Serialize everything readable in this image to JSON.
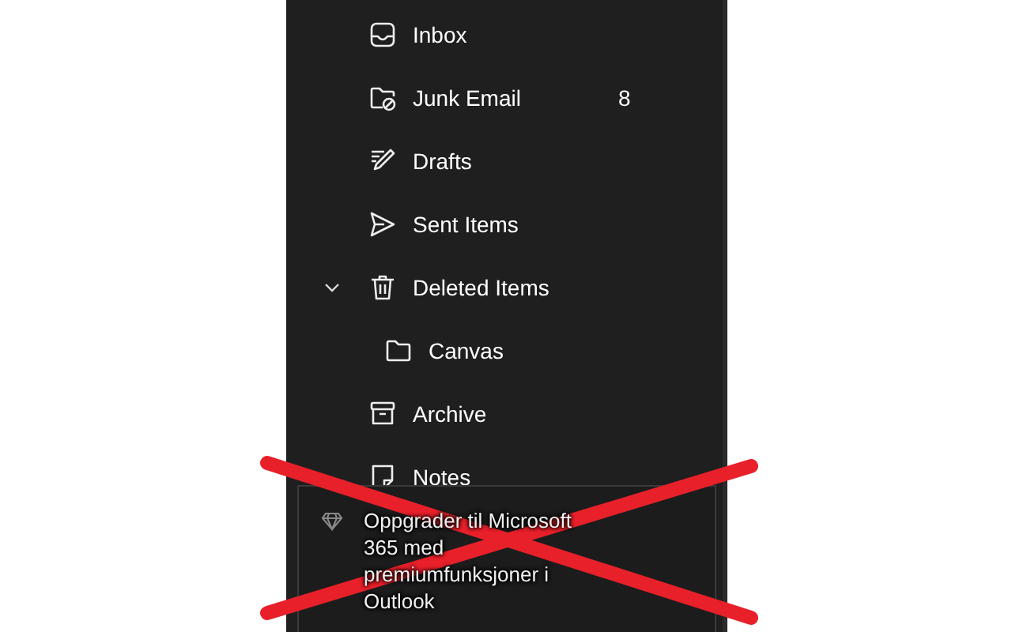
{
  "folders": [
    {
      "name": "Inbox"
    },
    {
      "name": "Junk Email",
      "count": "8"
    },
    {
      "name": "Drafts"
    },
    {
      "name": "Sent Items"
    },
    {
      "name": "Deleted Items",
      "expanded": true,
      "children": [
        {
          "name": "Canvas"
        }
      ]
    },
    {
      "name": "Archive"
    },
    {
      "name": "Notes"
    }
  ],
  "upgrade_banner": {
    "text": "Oppgrader til Microsoft 365 med premiumfunksjoner i Outlook"
  }
}
